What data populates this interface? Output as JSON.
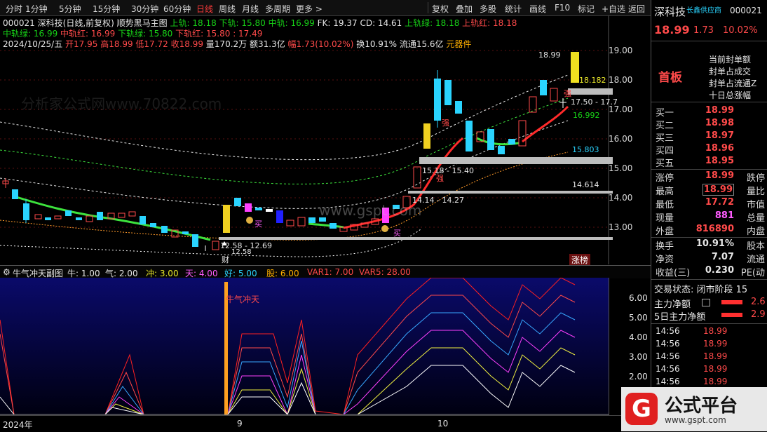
{
  "toolbar": {
    "items": [
      "分时",
      "1分钟",
      "5分钟",
      "15分钟",
      "30分钟",
      "60分钟",
      "日线",
      "周线",
      "月线",
      "多周期",
      "更多 >"
    ],
    "right_items": [
      "复权",
      "叠加",
      "多股",
      "统计",
      "画线",
      "F10",
      "标记",
      "+自选",
      "返回"
    ],
    "active": "日线"
  },
  "main": {
    "title_line": {
      "code": "000021",
      "name": "深科技(日线,前复权)",
      "indicator": "顺势黑马主图",
      "upper_rail": "上轨: 18.18",
      "lower_rail": "下轨: 15.80",
      "mid_rail": "中轨: 16.99",
      "fk": "FK: 19.37",
      "cd": "CD: 14.61",
      "upper_green": "上轨绿: 18.18",
      "upper_red": "上轨红: 18.18"
    },
    "line2": {
      "mid_green": "中轨绿: 16.99",
      "mid_red": "中轨红: 16.99",
      "lower_green": "下轨绿: 15.80",
      "lower_red": "下轨红: 15.80",
      "extra": ": 17.49"
    },
    "line3": {
      "date": "2024/10/25/五",
      "open": "开17.95",
      "high": "高18.99",
      "low": "低17.72",
      "close": "收18.99",
      "volume": "量170.2万",
      "amount": "额31.3亿",
      "amplitude": "幅1.73(10.02%)",
      "turnover": "换10.91%",
      "float": "流通15.6亿",
      "sector": "元器件"
    },
    "y_axis_ticks": [
      "19.00",
      "18.00",
      "17.00",
      "16.00",
      "15.00",
      "14.00",
      "13.00"
    ],
    "annotations": {
      "price_top": "18.99",
      "level_18182": "18.182",
      "range_1750": "17.50 - 17.7",
      "level_16992": "16.992",
      "level_15803": "15.803",
      "range_1518": "15.18 - 15.40",
      "level_14614": "14.614",
      "range_1414": "14.14 - 14.27",
      "range_1258": "12.58 - 12.69",
      "low_label": "12.58",
      "zhang_bang": "涨榜",
      "cai": "财",
      "qiang": "强",
      "mai": "买"
    },
    "watermark_domain": "www.gspt.com",
    "watermark_cn": "分析家公式网www.70822.com"
  },
  "sub": {
    "title": "牛气冲天副图",
    "params": [
      "牛: 1.00",
      "气: 2.00",
      "冲: 3.00",
      "天: 4.00",
      "好: 5.00",
      "股: 6.00",
      "VAR1: 7.00",
      "VAR5: 28.00"
    ],
    "y_axis_ticks": [
      "6.00",
      "5.00",
      "4.00",
      "3.00",
      "2.00"
    ],
    "signal_label": "牛气冲天"
  },
  "xaxis": {
    "labels": [
      "2024年",
      "9",
      "10"
    ]
  },
  "right": {
    "name": "深科技",
    "concept": "长鑫供应商",
    "code": "000021",
    "price": "18.99",
    "change": "1.73",
    "pct": "10.02%",
    "board_label": "首板",
    "limit_fields": [
      "当前封单额",
      "封单占成交",
      "封单占流通Z",
      "十日总涨幅"
    ],
    "bids": [
      {
        "label": "买一",
        "price": "18.99"
      },
      {
        "label": "买二",
        "price": "18.98"
      },
      {
        "label": "买三",
        "price": "18.97"
      },
      {
        "label": "买四",
        "price": "18.96"
      },
      {
        "label": "买五",
        "price": "18.95"
      }
    ],
    "stats": [
      {
        "label": "涨停",
        "value": "18.99",
        "label2": "跌停"
      },
      {
        "label": "最高",
        "value": "18.99",
        "label2": "量比"
      },
      {
        "label": "最低",
        "value": "17.72",
        "label2": "市值"
      },
      {
        "label": "现量",
        "value": "881",
        "label2": "总量"
      },
      {
        "label": "外盘",
        "value": "816890",
        "label2": "内盘"
      }
    ],
    "stats2": [
      {
        "label": "换手",
        "value": "10.91%",
        "label2": "股本"
      },
      {
        "label": "净资",
        "value": "7.07",
        "label2": "流通"
      },
      {
        "label": "收益(三)",
        "value": "0.230",
        "label2": "PE(动"
      }
    ],
    "trade_state": "交易状态: 闭市阶段 15",
    "main_flow": "主力净额",
    "main_flow_val": "2.6",
    "main_flow5": "5日主力净额",
    "main_flow5_val": "2.9",
    "ticks": [
      {
        "time": "14:56",
        "price": "18.99"
      },
      {
        "time": "14:56",
        "price": "18.99"
      },
      {
        "time": "14:56",
        "price": "18.99"
      },
      {
        "time": "14:56",
        "price": "18.99"
      },
      {
        "time": "14:56",
        "price": "18.99"
      }
    ]
  },
  "logo": {
    "text": "公式平台",
    "url": "www.gspt.com"
  }
}
